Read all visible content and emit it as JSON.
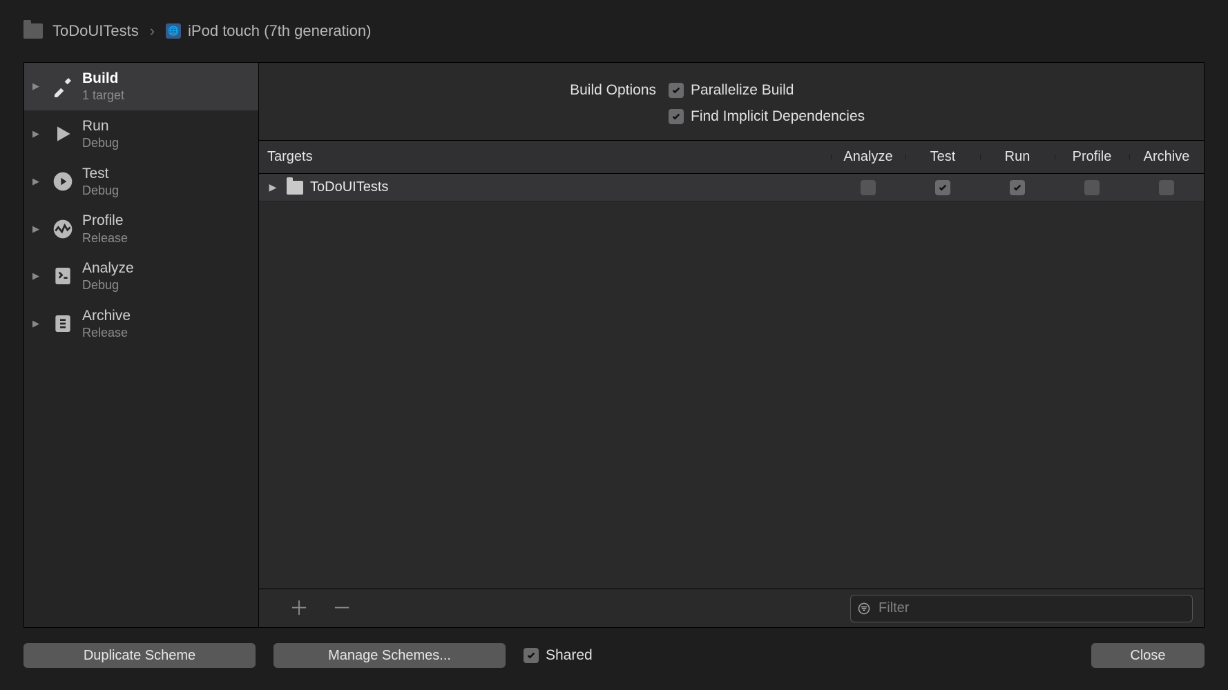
{
  "breadcrumb": {
    "scheme": "ToDoUITests",
    "destination": "iPod touch (7th generation)"
  },
  "sidebar": {
    "items": [
      {
        "title": "Build",
        "subtitle": "1 target"
      },
      {
        "title": "Run",
        "subtitle": "Debug"
      },
      {
        "title": "Test",
        "subtitle": "Debug"
      },
      {
        "title": "Profile",
        "subtitle": "Release"
      },
      {
        "title": "Analyze",
        "subtitle": "Debug"
      },
      {
        "title": "Archive",
        "subtitle": "Release"
      }
    ]
  },
  "options": {
    "heading": "Build Options",
    "parallelize": {
      "label": "Parallelize Build",
      "checked": true
    },
    "implicit": {
      "label": "Find Implicit Dependencies",
      "checked": true
    }
  },
  "table": {
    "headers": {
      "targets": "Targets",
      "analyze": "Analyze",
      "test": "Test",
      "run": "Run",
      "profile": "Profile",
      "archive": "Archive"
    },
    "rows": [
      {
        "name": "ToDoUITests",
        "analyze": false,
        "test": true,
        "run": true,
        "profile": false,
        "archive": false
      }
    ]
  },
  "filter": {
    "placeholder": "Filter"
  },
  "footer": {
    "duplicate": "Duplicate Scheme",
    "manage": "Manage Schemes...",
    "shared": {
      "label": "Shared",
      "checked": true
    },
    "close": "Close"
  }
}
